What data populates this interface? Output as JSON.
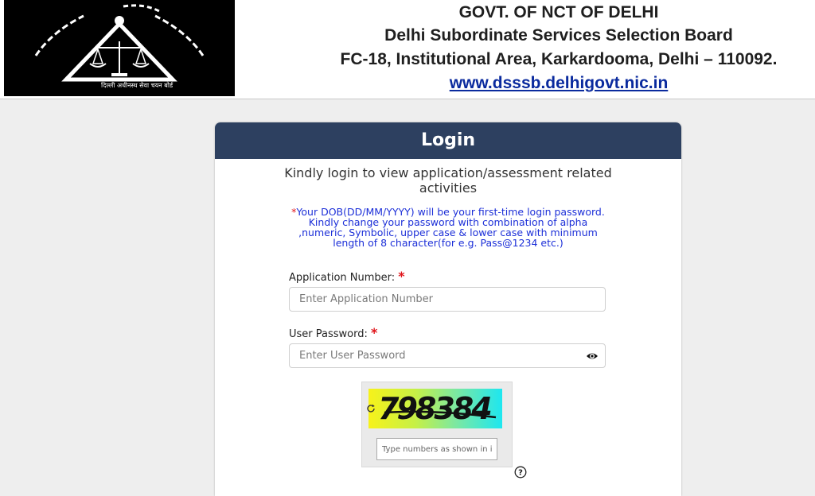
{
  "header": {
    "logo_caption": "दिल्ली अधीनस्थ सेवा चयन बोर्ड",
    "line1": "GOVT. OF NCT OF DELHI",
    "line2": "Delhi Subordinate Services Selection Board",
    "line3": "FC-18, Institutional Area, Karkardooma, Delhi – 110092.",
    "website": "www.dsssb.delhigovt.nic.in"
  },
  "login": {
    "title": "Login",
    "intro": "Kindly login to view application/assessment related activities",
    "note_star": "*",
    "note": "Your DOB(DD/MM/YYYY) will be your first-time login password. Kindly change your password with combination of alpha ,numeric, Symbolic, upper case & lower case with minimum length of 8 character(for e.g. Pass@1234 etc.)",
    "application_label": "Application Number:",
    "application_placeholder": "Enter Application Number",
    "password_label": "User Password:",
    "password_placeholder": "Enter User Password",
    "required_mark": "*",
    "captcha_code": "798384",
    "captcha_placeholder": "Type numbers as shown in image"
  },
  "icons": {
    "eye": "eye-icon",
    "refresh": "refresh-icon",
    "help": "help-icon"
  },
  "colors": {
    "header_bar": "#2d4060",
    "note_text": "#1c2fd8",
    "required": "#e0141a",
    "link": "#0a2a9e"
  }
}
